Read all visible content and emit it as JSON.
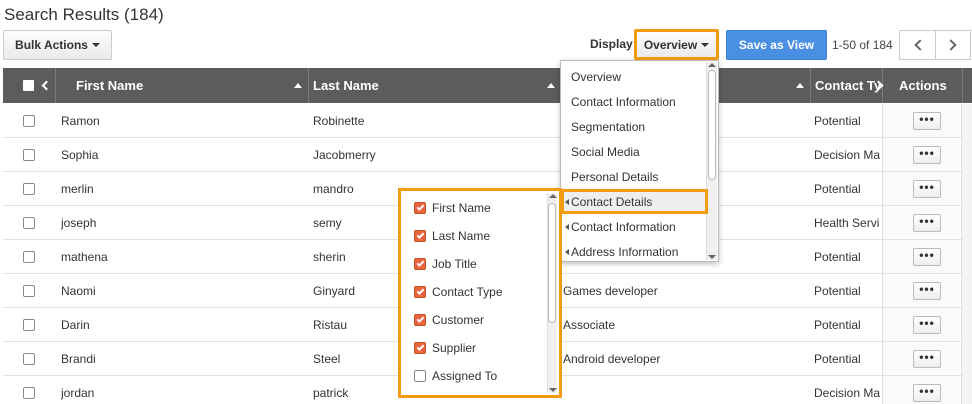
{
  "page": {
    "title": "Search Results (184)"
  },
  "toolbar": {
    "bulk_actions": "Bulk Actions",
    "display_label": "Display",
    "display_value": "Overview",
    "save_as_view": "Save as View",
    "range": "1-50 of 184"
  },
  "colors": {
    "accent_highlight": "#f39c12",
    "primary_button": "#4a90e2",
    "header_bg": "#5c5c5c",
    "checkbox_checked": "#e8643c"
  },
  "table": {
    "headers": {
      "first_name": "First Name",
      "last_name": "Last Name",
      "contact_type": "Contact Ty",
      "actions": "Actions"
    },
    "rows": [
      {
        "first": "Ramon",
        "last": "Robinette",
        "title": "",
        "type": "Potential"
      },
      {
        "first": "Sophia",
        "last": "Jacobmerry",
        "title": "",
        "type": "Decision Ma"
      },
      {
        "first": "merlin",
        "last": "mandro",
        "title": "",
        "type": "Potential"
      },
      {
        "first": "joseph",
        "last": "semy",
        "title": "",
        "type": "Health Servi"
      },
      {
        "first": "mathena",
        "last": "sherin",
        "title": "",
        "type": "Potential"
      },
      {
        "first": "Naomi",
        "last": "Ginyard",
        "title": "Games developer",
        "type": "Potential"
      },
      {
        "first": "Darin",
        "last": "Ristau",
        "title": "Associate",
        "type": "Potential"
      },
      {
        "first": "Brandi",
        "last": "Steel",
        "title": "Android developer",
        "type": "Potential"
      },
      {
        "first": "jordan",
        "last": "patrick",
        "title": "",
        "type": "Decision Ma"
      }
    ],
    "row_action_label": "•••"
  },
  "display_menu": {
    "items": [
      {
        "label": "Overview",
        "sub": false,
        "active": false
      },
      {
        "label": "Contact Information",
        "sub": false,
        "active": false
      },
      {
        "label": "Segmentation",
        "sub": false,
        "active": false
      },
      {
        "label": "Social Media",
        "sub": false,
        "active": false
      },
      {
        "label": "Personal Details",
        "sub": false,
        "active": false
      },
      {
        "label": "Contact Details",
        "sub": true,
        "active": true
      },
      {
        "label": "Contact Information",
        "sub": true,
        "active": false
      },
      {
        "label": "Address Information",
        "sub": true,
        "active": false
      }
    ]
  },
  "columns_menu": {
    "items": [
      {
        "label": "First Name",
        "checked": true
      },
      {
        "label": "Last Name",
        "checked": true
      },
      {
        "label": "Job Title",
        "checked": true
      },
      {
        "label": "Contact Type",
        "checked": true
      },
      {
        "label": "Customer",
        "checked": true
      },
      {
        "label": "Supplier",
        "checked": true
      },
      {
        "label": "Assigned To",
        "checked": false
      }
    ]
  }
}
